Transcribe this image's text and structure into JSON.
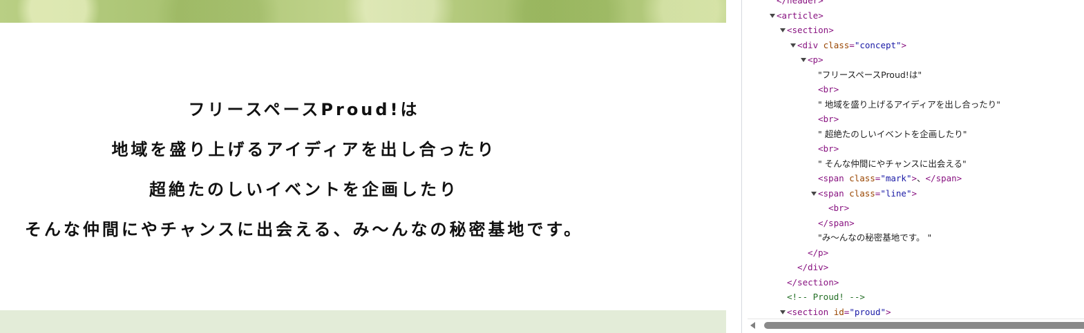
{
  "page": {
    "concept": {
      "line1": "フリースペースProud!は",
      "line2": "地域を盛り上げるアイディアを出し合ったり",
      "line3": "超絶たのしいイベントを企画したり",
      "line4a": "そんな仲間にやチャンスに出会える",
      "mark": "、",
      "line4b": "み〜んなの秘密基地です。"
    }
  },
  "devtools": {
    "rows": {
      "header_close": "</header>",
      "article_open": "<article>",
      "section_open": "<section>",
      "div_open_tag": "<div ",
      "div_attr": "class",
      "div_eq": "=",
      "div_val": "\"concept\"",
      "div_close_bracket": ">",
      "p_open": "<p>",
      "text1": "\"フリースペースProud!は\"",
      "br1": "<br>",
      "text2": "\" 地域を盛り上げるアイディアを出し合ったり\"",
      "br2": "<br>",
      "text3": "\" 超絶たのしいイベントを企画したり\"",
      "br3": "<br>",
      "text4": "\" そんな仲間にやチャンスに出会える\"",
      "span_mark_open": "<span ",
      "span_mark_attr": "class",
      "span_mark_eq": "=",
      "span_mark_val": "\"mark\"",
      "span_mark_gt": ">",
      "span_mark_text": "、",
      "span_mark_close": "</span>",
      "span_line_open": "<span ",
      "span_line_attr": "class",
      "span_line_eq": "=",
      "span_line_val": "\"line\"",
      "span_line_gt": ">",
      "br4": "<br>",
      "span_line_close": "</span>",
      "text5": "\"み〜んなの秘密基地です。 \"",
      "p_close": "</p>",
      "div_close": "</div>",
      "section_close": "</section>",
      "comment": "<!-- Proud! -->",
      "section2_open_tag": "<section ",
      "section2_attr": "id",
      "section2_eq": "=",
      "section2_val": "\"proud\"",
      "section2_gt": ">"
    }
  },
  "colors": {
    "tag": "#881280",
    "attr": "#994500",
    "value": "#1a1aa6",
    "comment": "#236e25",
    "green_strip": "#e3ecd8"
  }
}
